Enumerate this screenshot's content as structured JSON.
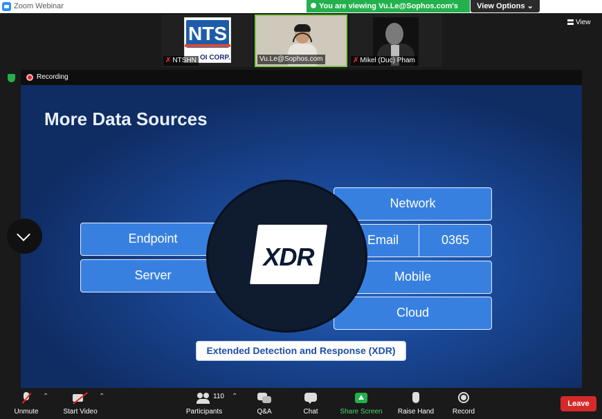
{
  "window": {
    "title": "Zoom Webinar"
  },
  "banner": {
    "viewing_text": "You are viewing Vu.Le@Sophos.com's screen",
    "view_options": "View Options ⌄"
  },
  "gallery": {
    "view_label": "View",
    "tiles": [
      {
        "name": "NTSHN",
        "muted": true,
        "logo_text": "NTS",
        "logo_sub": "OI CORP."
      },
      {
        "name": "Vu.Le@Sophos.com",
        "muted": false
      },
      {
        "name": "Mikel (Duc) Pham",
        "muted": true
      }
    ]
  },
  "recording": {
    "label": "Recording"
  },
  "slide": {
    "title": "More Data Sources",
    "left_boxes": [
      "Endpoint",
      "Server"
    ],
    "right_boxes": {
      "network": "Network",
      "email": "Email",
      "o365": "0365",
      "mobile": "Mobile",
      "cloud": "Cloud"
    },
    "center_logo": "XDR",
    "caption": "Extended Detection and Response (XDR)"
  },
  "toolbar": {
    "unmute": "Unmute",
    "start_video": "Start Video",
    "participants": "Participants",
    "participant_count": "110",
    "qa": "Q&A",
    "chat": "Chat",
    "share_screen": "Share Screen",
    "raise_hand": "Raise Hand",
    "record": "Record",
    "leave": "Leave"
  },
  "colors": {
    "accent_green": "#22b14c",
    "leave_red": "#d62a2a",
    "slide_blue": "#1a4896"
  }
}
